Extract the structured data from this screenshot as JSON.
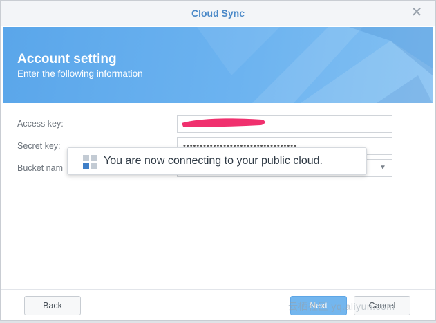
{
  "window": {
    "title": "Cloud Sync",
    "close_icon": "close-icon"
  },
  "banner": {
    "heading": "Account setting",
    "subheading": "Enter the following information"
  },
  "form": {
    "access_key_label": "Access key:",
    "secret_key_label": "Secret key:",
    "bucket_name_label": "Bucket nam",
    "secret_key_value": "••••••••••••••••••••••••••••••••••"
  },
  "toast": {
    "message": "You are now connecting to your public cloud.",
    "icon": "cloud-sync-app-icon"
  },
  "footer": {
    "back_label": "Back",
    "next_label": "Next",
    "cancel_label": "Cancel"
  },
  "watermark": "云栖社区 yq.aliyun.com",
  "colors": {
    "title": "#4b89c8",
    "banner": "#6cb3f0",
    "primary_button": "#73b6ee",
    "redaction": "#f0306e"
  }
}
